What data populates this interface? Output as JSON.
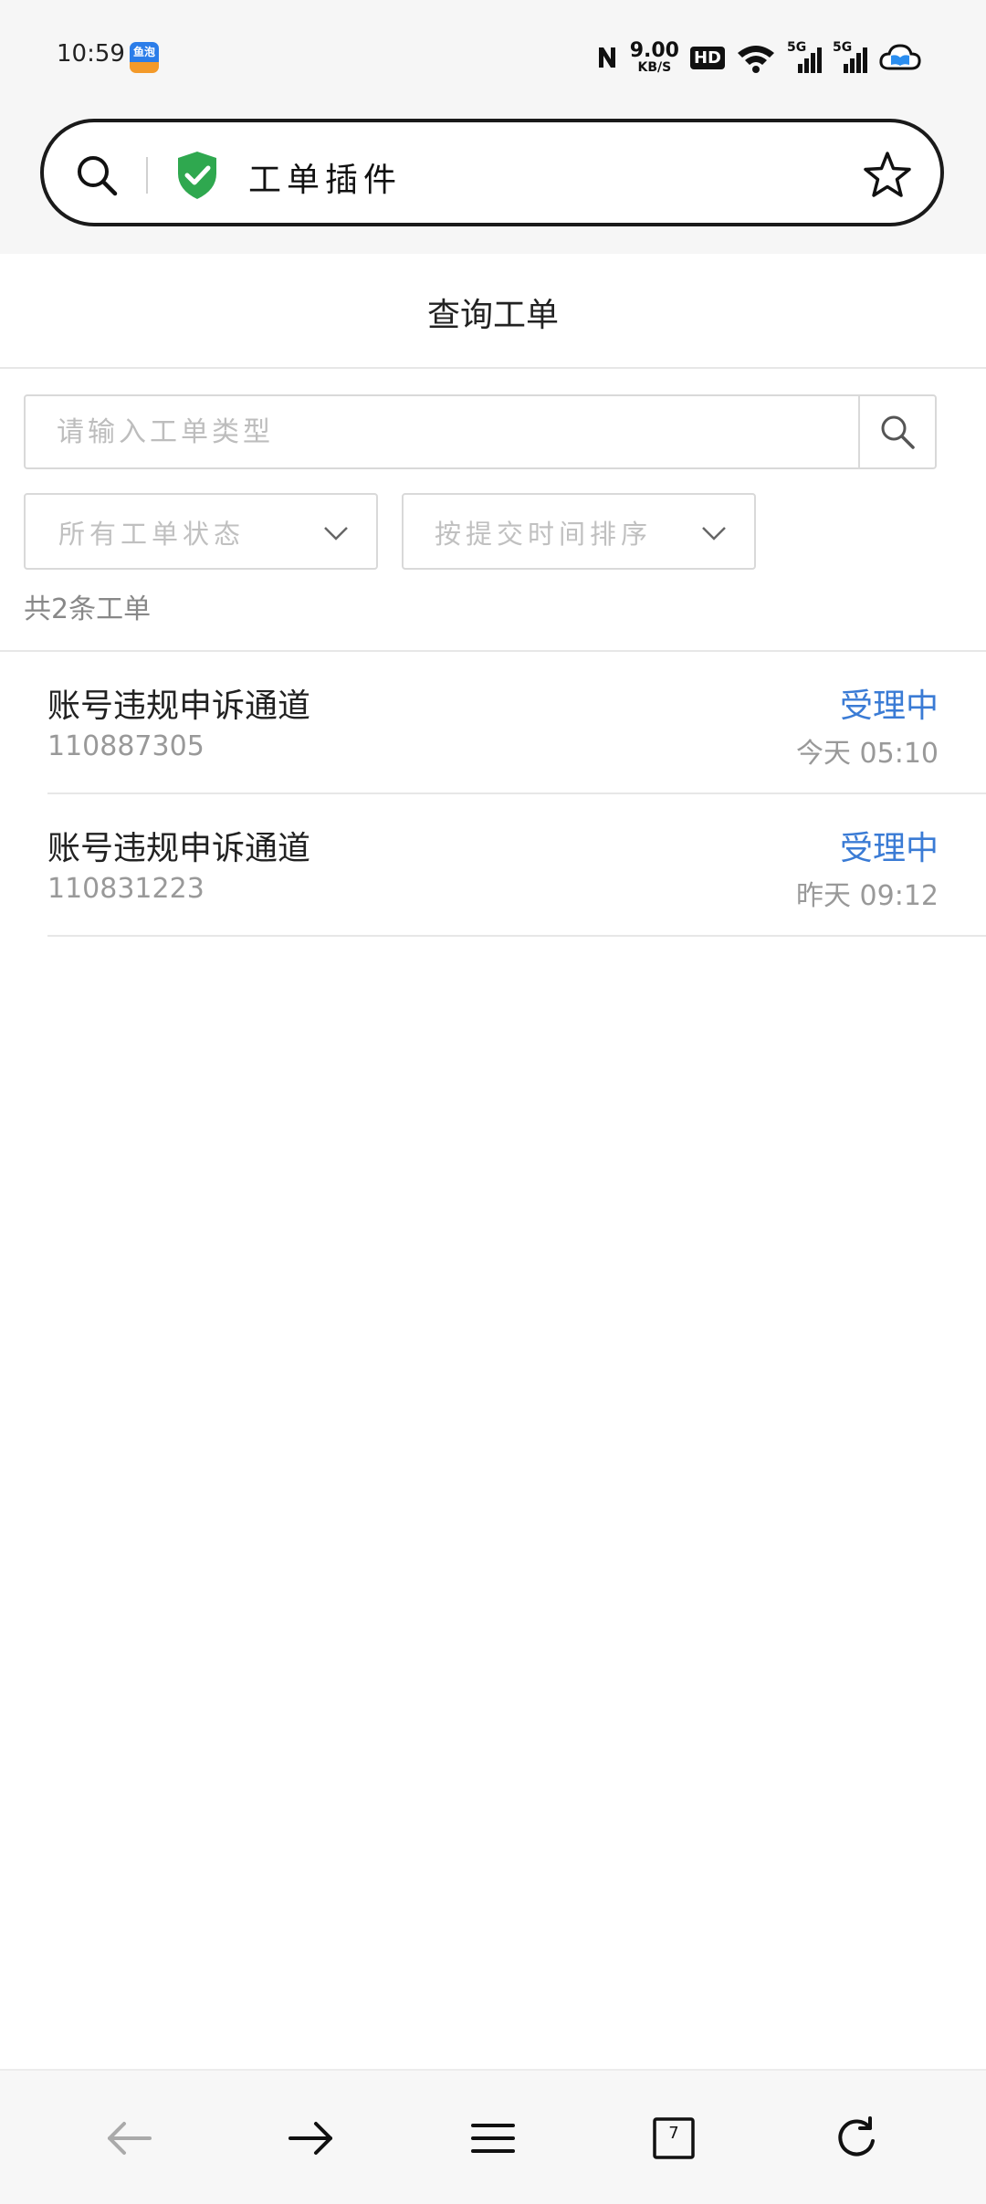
{
  "status_bar": {
    "time": "10:59",
    "app_icon_text": "鱼泡",
    "net_speed_value": "9.00",
    "net_speed_unit": "KB/S",
    "hd_label": "HD",
    "signal1_label": "5G",
    "signal2_label": "5G"
  },
  "address_bar": {
    "title": "工单插件",
    "shield_color": "#2fa84f"
  },
  "page": {
    "title": "查询工单"
  },
  "search": {
    "placeholder": "请输入工单类型"
  },
  "filters": {
    "status_label": "所有工单状态",
    "sort_label": "按提交时间排序"
  },
  "count_text": "共2条工单",
  "tickets": [
    {
      "title": "账号违规申诉通道",
      "id": "110887305",
      "status": "受理中",
      "time": "今天 05:10"
    },
    {
      "title": "账号违规申诉通道",
      "id": "110831223",
      "status": "受理中",
      "time": "昨天 09:12"
    }
  ],
  "bottom_nav": {
    "tab_count": "7"
  },
  "colors": {
    "accent": "#3a7bd5",
    "shield": "#2fa84f"
  }
}
